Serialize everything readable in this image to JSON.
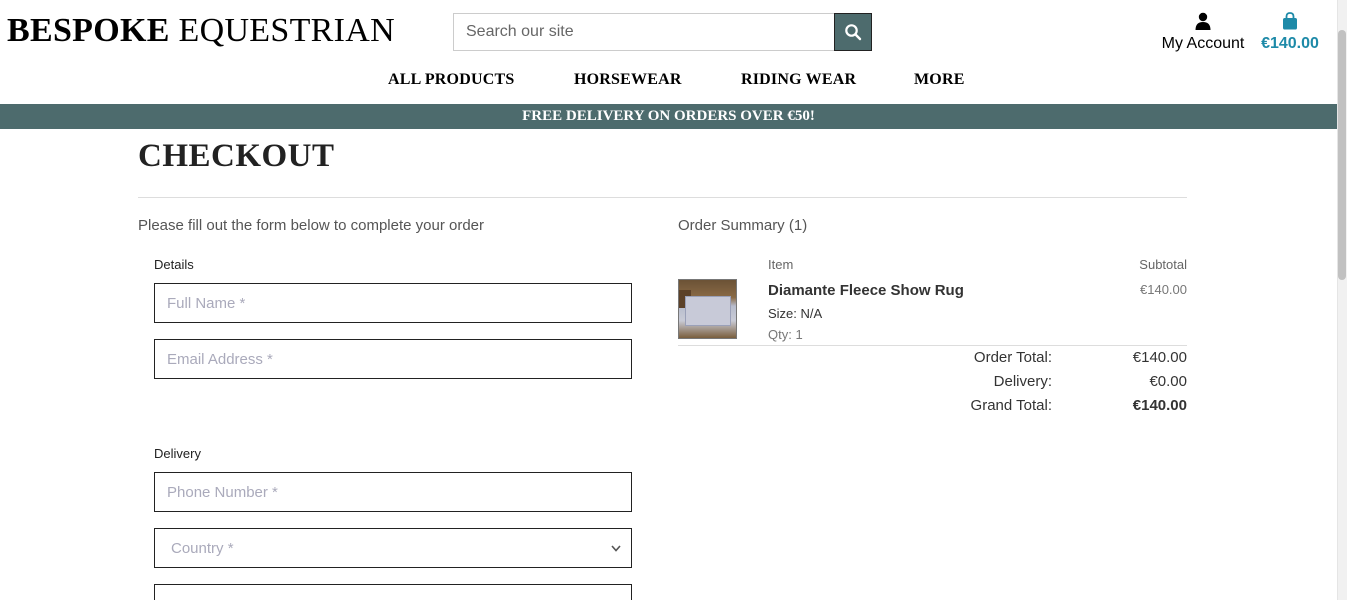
{
  "header": {
    "brand_bold": "BESPOKE",
    "brand_rest": "EQUESTRIAN",
    "search_placeholder": "Search our site",
    "account_label": "My Account",
    "cart_total": "€140.00"
  },
  "nav": {
    "items": [
      "ALL PRODUCTS",
      "HORSEWEAR",
      "RIDING WEAR",
      "MORE"
    ]
  },
  "banner": {
    "text": "FREE DELIVERY ON ORDERS OVER €50!"
  },
  "checkout": {
    "title": "CHECKOUT",
    "intro": "Please fill out the form below to complete your order",
    "details_label": "Details",
    "full_name_placeholder": "Full Name *",
    "email_placeholder": "Email Address *",
    "delivery_label": "Delivery",
    "phone_placeholder": "Phone Number *",
    "country_placeholder": "Country *"
  },
  "summary": {
    "title": "Order Summary (1)",
    "col_item": "Item",
    "col_subtotal": "Subtotal",
    "product": {
      "name": "Diamante Fleece Show Rug",
      "size": "Size: N/A",
      "qty": "Qty: 1",
      "price": "€140.00"
    },
    "order_total_label": "Order Total:",
    "order_total": "€140.00",
    "delivery_label": "Delivery:",
    "delivery": "€0.00",
    "grand_total_label": "Grand Total:",
    "grand_total": "€140.00"
  },
  "colors": {
    "accent_teal": "#4d6b6d",
    "cart_blue": "#1e8aa8"
  },
  "icons": [
    "search-icon",
    "user-icon",
    "shopping-bag-icon",
    "chevron-down-icon"
  ]
}
